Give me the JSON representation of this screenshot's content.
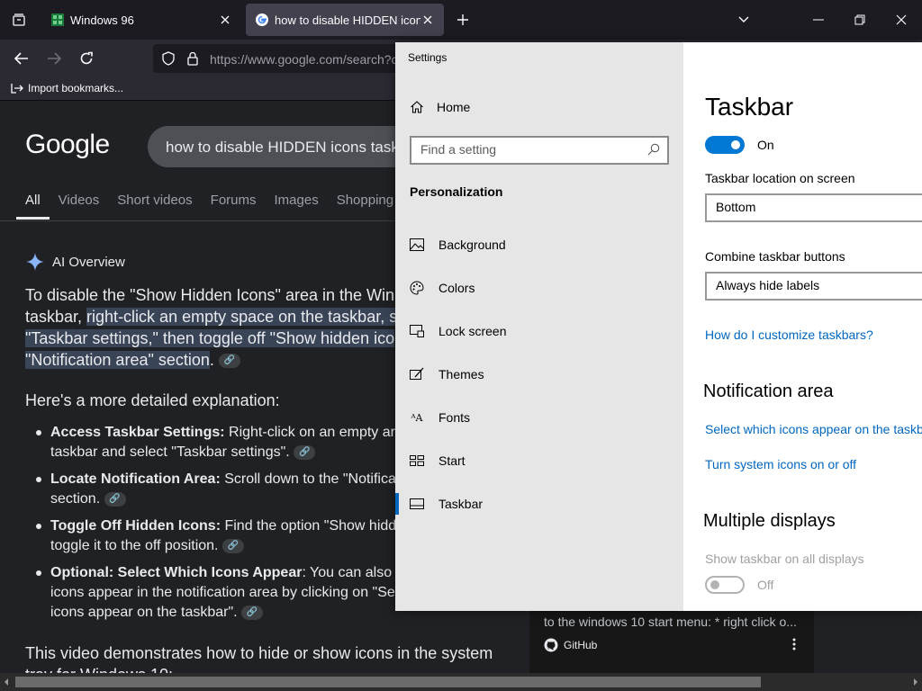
{
  "browser": {
    "tabs": [
      {
        "title": "Windows 96",
        "active": false
      },
      {
        "title": "how to disable HIDDEN icons t",
        "active": true
      }
    ],
    "url": "https://www.google.com/search?c",
    "bookmarks": {
      "import_label": "Import bookmarks..."
    }
  },
  "google": {
    "logo": "Google",
    "query": "how to disable HIDDEN icons taskb",
    "tabs": [
      "All",
      "Videos",
      "Short videos",
      "Forums",
      "Images",
      "Shopping"
    ],
    "ai_overview": {
      "heading": "AI Overview",
      "para_line1": "To disable the \"Show Hidden Icons\" area in the Win",
      "para_line2_plain": "taskbar, ",
      "para_line2_hl": "right-click an empty space on the taskbar, s",
      "para_line3_hl": "\"Taskbar settings,\" then toggle off \"Show hidden ico",
      "para_line4_hl": "\"Notification area\" section",
      "para_line4_tail": ".",
      "subheading": "Here's a more detailed explanation:",
      "bullets": [
        {
          "bold": "Access Taskbar Settings:",
          "text1": " Right-click on an empty ar",
          "text2": "taskbar and select \"Taskbar settings\"."
        },
        {
          "bold": "Locate Notification Area:",
          "text1": " Scroll down to the \"Notifica",
          "text2": "section."
        },
        {
          "bold": "Toggle Off Hidden Icons:",
          "text1": " Find the option \"Show hidd",
          "text2": "toggle it to the off position."
        },
        {
          "bold": "Optional: Select Which Icons Appear",
          "text1": ": You can also",
          "text2": "icons appear in the notification area by clicking on \"Se",
          "text3": "icons appear on the taskbar\"."
        }
      ],
      "video_line1": "This video demonstrates how to hide or show icons in the system",
      "video_line2": "tray for Windows 10:"
    },
    "github_card": {
      "snippet": "to the windows 10 start menu: * right click o...",
      "source": "GitHub"
    }
  },
  "settings": {
    "window_title": "Settings",
    "home": "Home",
    "search_placeholder": "Find a setting",
    "section": "Personalization",
    "nav": [
      {
        "label": "Background",
        "icon": "picture-icon"
      },
      {
        "label": "Colors",
        "icon": "palette-icon"
      },
      {
        "label": "Lock screen",
        "icon": "lock-screen-icon"
      },
      {
        "label": "Themes",
        "icon": "themes-icon"
      },
      {
        "label": "Fonts",
        "icon": "fonts-icon"
      },
      {
        "label": "Start",
        "icon": "start-icon"
      },
      {
        "label": "Taskbar",
        "icon": "taskbar-icon",
        "active": true
      }
    ],
    "page": {
      "title": "Taskbar",
      "toggle_state": "On",
      "location_label": "Taskbar location on screen",
      "location_value": "Bottom",
      "combine_label": "Combine taskbar buttons",
      "combine_value": "Always hide labels",
      "customize_link": "How do I customize taskbars?",
      "notification_heading": "Notification area",
      "select_icons_link": "Select which icons appear on the taskba",
      "system_icons_link": "Turn system icons on or off",
      "multi_heading": "Multiple displays",
      "show_all_label": "Show taskbar on all displays",
      "show_all_state": "Off"
    }
  },
  "colors": {
    "accent": "#0078d4",
    "link": "#0067c0",
    "highlight": "#394457"
  }
}
